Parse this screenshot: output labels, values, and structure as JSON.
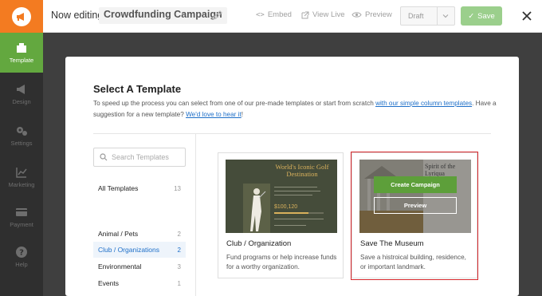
{
  "header": {
    "now_editing": "Now editing",
    "campaign_name": "Crowdfunding Campaign",
    "embed": "Embed",
    "view_live": "View Live",
    "preview": "Preview",
    "status": "Draft",
    "save": "Save"
  },
  "sidebar": {
    "items": [
      {
        "label": "Template",
        "icon": "template-icon"
      },
      {
        "label": "Design",
        "icon": "megaphone-icon"
      },
      {
        "label": "Settings",
        "icon": "gears-icon"
      },
      {
        "label": "Marketing",
        "icon": "chart-icon"
      },
      {
        "label": "Payment",
        "icon": "card-icon"
      },
      {
        "label": "Help",
        "icon": "question-icon"
      }
    ]
  },
  "modal": {
    "title": "Select A Template",
    "desc_part1": "To speed up the process you can select from one of our pre-made templates or start from scratch ",
    "desc_link1": "with our simple column templates",
    "desc_part2": ". Have a suggestion for a new template? ",
    "desc_link2": "We'd love to hear it",
    "desc_part3": "!",
    "search_placeholder": "Search Templates",
    "categories": [
      {
        "label": "All Templates",
        "count": "13"
      },
      {
        "label": "Animal / Pets",
        "count": "2"
      },
      {
        "label": "Club / Organizations",
        "count": "2"
      },
      {
        "label": "Environmental",
        "count": "3"
      },
      {
        "label": "Events",
        "count": "1"
      }
    ],
    "cards": [
      {
        "title": "Club / Organization",
        "description": "Fund programs or help increase funds for a worthy organization.",
        "thumb_title": "World's Iconic Golf Destination",
        "thumb_amount": "$100,120"
      },
      {
        "title": "Save The Museum",
        "description": "Save a histroical building, residence, or important landmark.",
        "thumb_title": "Spirit of the Lyriqua",
        "create_label": "Create Campaign",
        "preview_label": "Preview"
      }
    ]
  },
  "colors": {
    "brand": "#f37b21",
    "accent_green": "#63a83f",
    "link_blue": "#1e6fc8",
    "highlight_red": "#d6262b"
  }
}
